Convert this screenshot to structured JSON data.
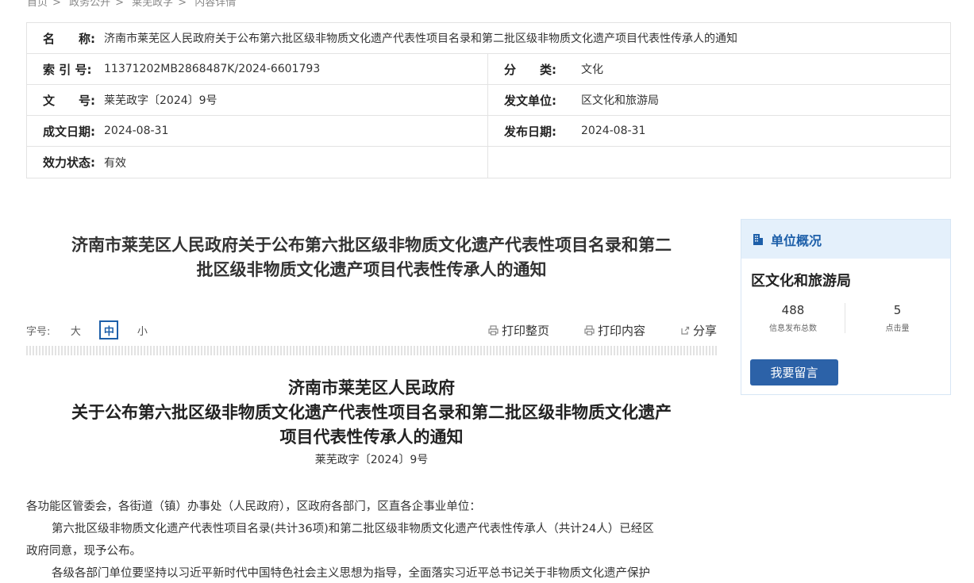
{
  "breadcrumb": [
    "首页",
    "政务公开",
    "莱芜政字",
    "内容详情"
  ],
  "meta": {
    "name_label": "名　　称:",
    "name_value": "济南市莱芜区人民政府关于公布第六批区级非物质文化遗产代表性项目名录和第二批区级非物质文化遗产项目代表性传承人的通知",
    "index_label": "索 引 号:",
    "index_value": "11371202MB2868487K/2024-6601793",
    "category_label": "分　　类:",
    "category_value": "文化",
    "docno_label": "文　　号:",
    "docno_value": "莱芜政字〔2024〕9号",
    "issuer_label": "发文单位:",
    "issuer_value": "区文化和旅游局",
    "created_label": "成文日期:",
    "created_value": "2024-08-31",
    "published_label": "发布日期:",
    "published_value": "2024-08-31",
    "status_label": "效力状态:",
    "status_value": "有效"
  },
  "article": {
    "title_line1": "济南市莱芜区人民政府关于公布第六批区级非物质文化遗产代表性项目名录和第二",
    "title_line2": "批区级非物质文化遗产项目代表性传承人的通知",
    "font_size_label": "字号:",
    "font_large": "大",
    "font_medium": "中",
    "font_small": "小",
    "print_page": "打印整页",
    "print_content": "打印内容",
    "share": "分享",
    "head_line1": "济南市莱芜区人民政府",
    "head_line2": "关于公布第六批区级非物质文化遗产代表性项目名录和第二批区级非物质文化遗产",
    "head_line3": "项目代表性传承人的通知",
    "doc_number": "莱芜政字〔2024〕9号",
    "para1": "各功能区管委会，各街道（镇）办事处（人民政府），区政府各部门，区直各企事业单位：",
    "para2_line1": "第六批区级非物质文化遗产代表性项目名录(共计36项)和第二批区级非物质文化遗产代表性传承人（共计24人）已经区",
    "para2_line2": "政府同意，现予公布。",
    "para3": "各级各部门单位要坚持以习近平新时代中国特色社会主义思想为指导，全面落实习近平总书记关于非物质文化遗产保护"
  },
  "sidebar": {
    "title": "单位概况",
    "org_name": "区文化和旅游局",
    "stat1_value": "488",
    "stat1_caption": "信息发布总数",
    "stat2_value": "5",
    "stat2_caption": "点击量",
    "message_button": "我要留言"
  },
  "colors": {
    "accent": "#1d5fa9",
    "button": "#2c62a8",
    "sidebar_header": "#e4f0fb"
  }
}
